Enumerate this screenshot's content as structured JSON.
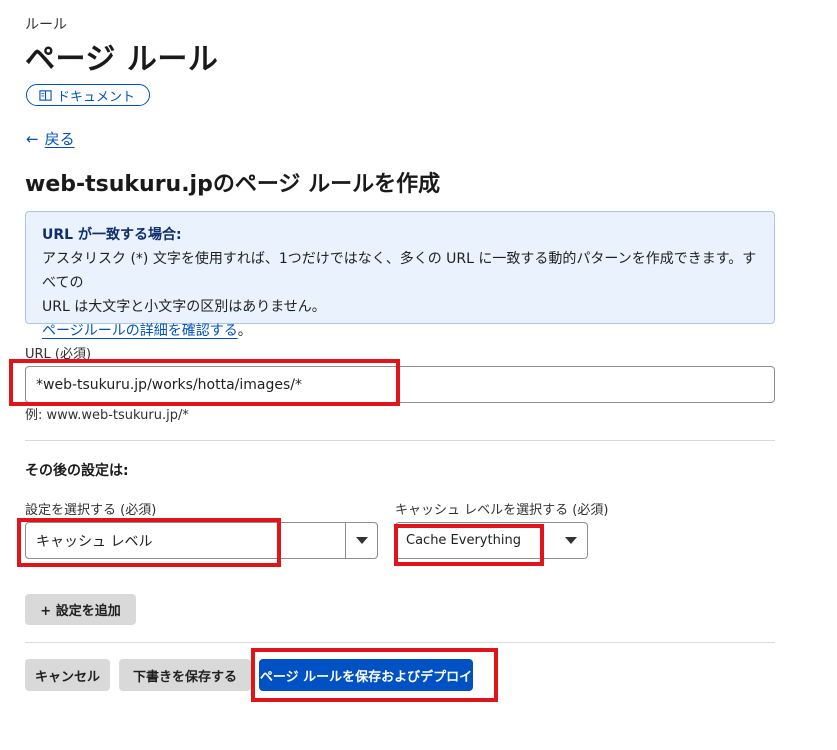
{
  "header": {
    "breadcrumb": "ルール",
    "title": "ページ ルール",
    "docs_label": "ドキュメント"
  },
  "nav": {
    "back_label": "戻る"
  },
  "form": {
    "title": "web-tsukuru.jpのページ ルールを作成",
    "info": {
      "heading": "URL が一致する場合:",
      "line1": "アスタリスク (*) 文字を使用すれば、1つだけではなく、多くの URL に一致する動的パターンを作成できます。すべての",
      "line2": "URL は大文字と小文字の区別はありません。",
      "link": "ページルールの詳細を確認する",
      "link_suffix": "。"
    },
    "url_label": "URL (必須)",
    "url_value": "*web-tsukuru.jp/works/hotta/images/*",
    "url_hint": "例: www.web-tsukuru.jp/*",
    "after_label": "その後の設定は:",
    "setting_label": "設定を選択する (必須)",
    "setting_value": "キャッシュ レベル",
    "cache_label": "キャッシュ レベルを選択する (必須)",
    "cache_value": "Cache Everything",
    "add_setting": "+ 設定を追加"
  },
  "actions": {
    "cancel": "キャンセル",
    "save_draft": "下書きを保存する",
    "save_deploy": "ページ ルールを保存およびデプロイ"
  },
  "colors": {
    "accent": "#0051c3",
    "highlight": "#e1141a",
    "info_bg": "#eaf2fd"
  }
}
